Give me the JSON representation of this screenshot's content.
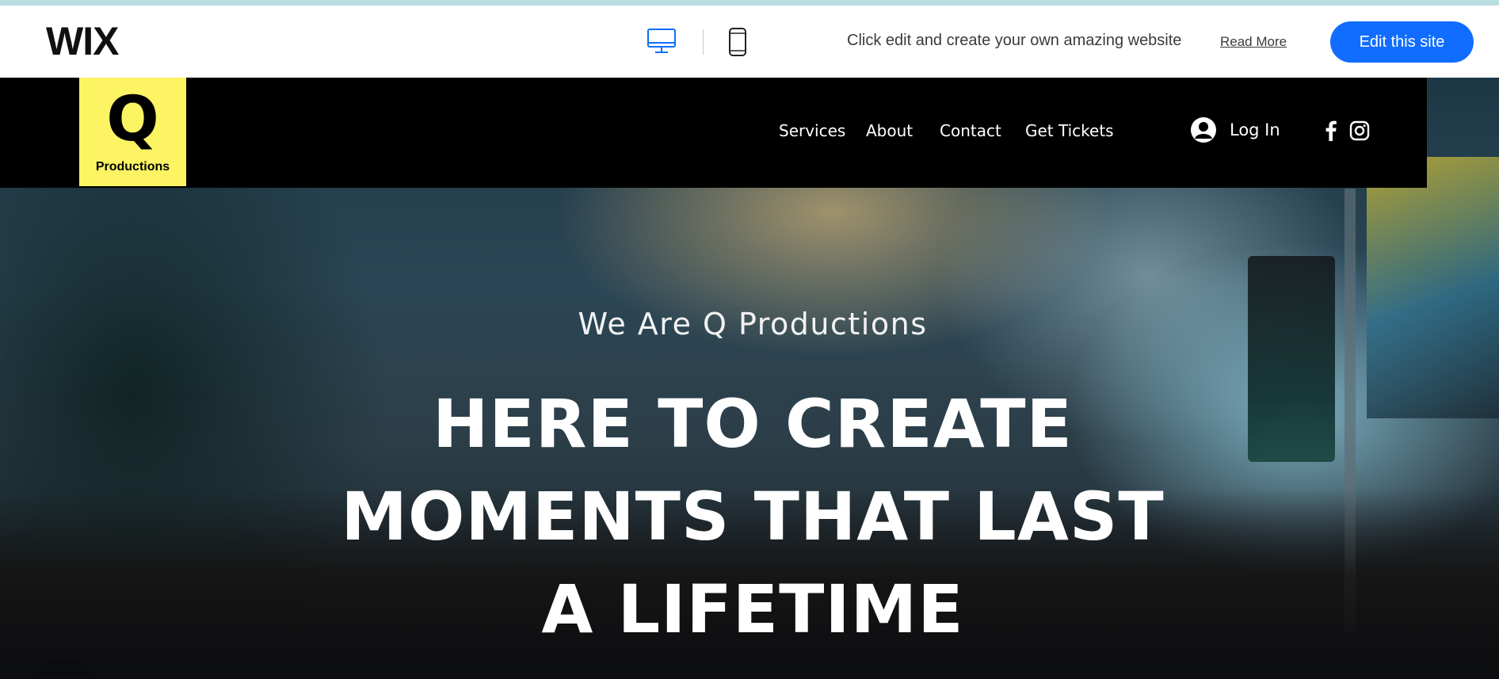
{
  "wix_banner": {
    "logo": "WIX",
    "device_icons": [
      "desktop-icon",
      "mobile-icon"
    ],
    "promo_text": "Click edit and create your own amazing website",
    "read_more": "Read More",
    "edit_button": "Edit this site",
    "accent_color": "#116dff"
  },
  "site": {
    "logo_letter": "Q",
    "logo_text": "Productions",
    "logo_color": "#fdf463",
    "nav": [
      "Services",
      "About",
      "Contact",
      "Get Tickets"
    ],
    "login": "Log In",
    "social": [
      "facebook-icon",
      "instagram-icon"
    ]
  },
  "hero": {
    "subtitle": "We Are Q Productions",
    "title_lines": [
      "HERE TO CREATE",
      "MOMENTS THAT LAST",
      "A LIFETIME"
    ]
  }
}
